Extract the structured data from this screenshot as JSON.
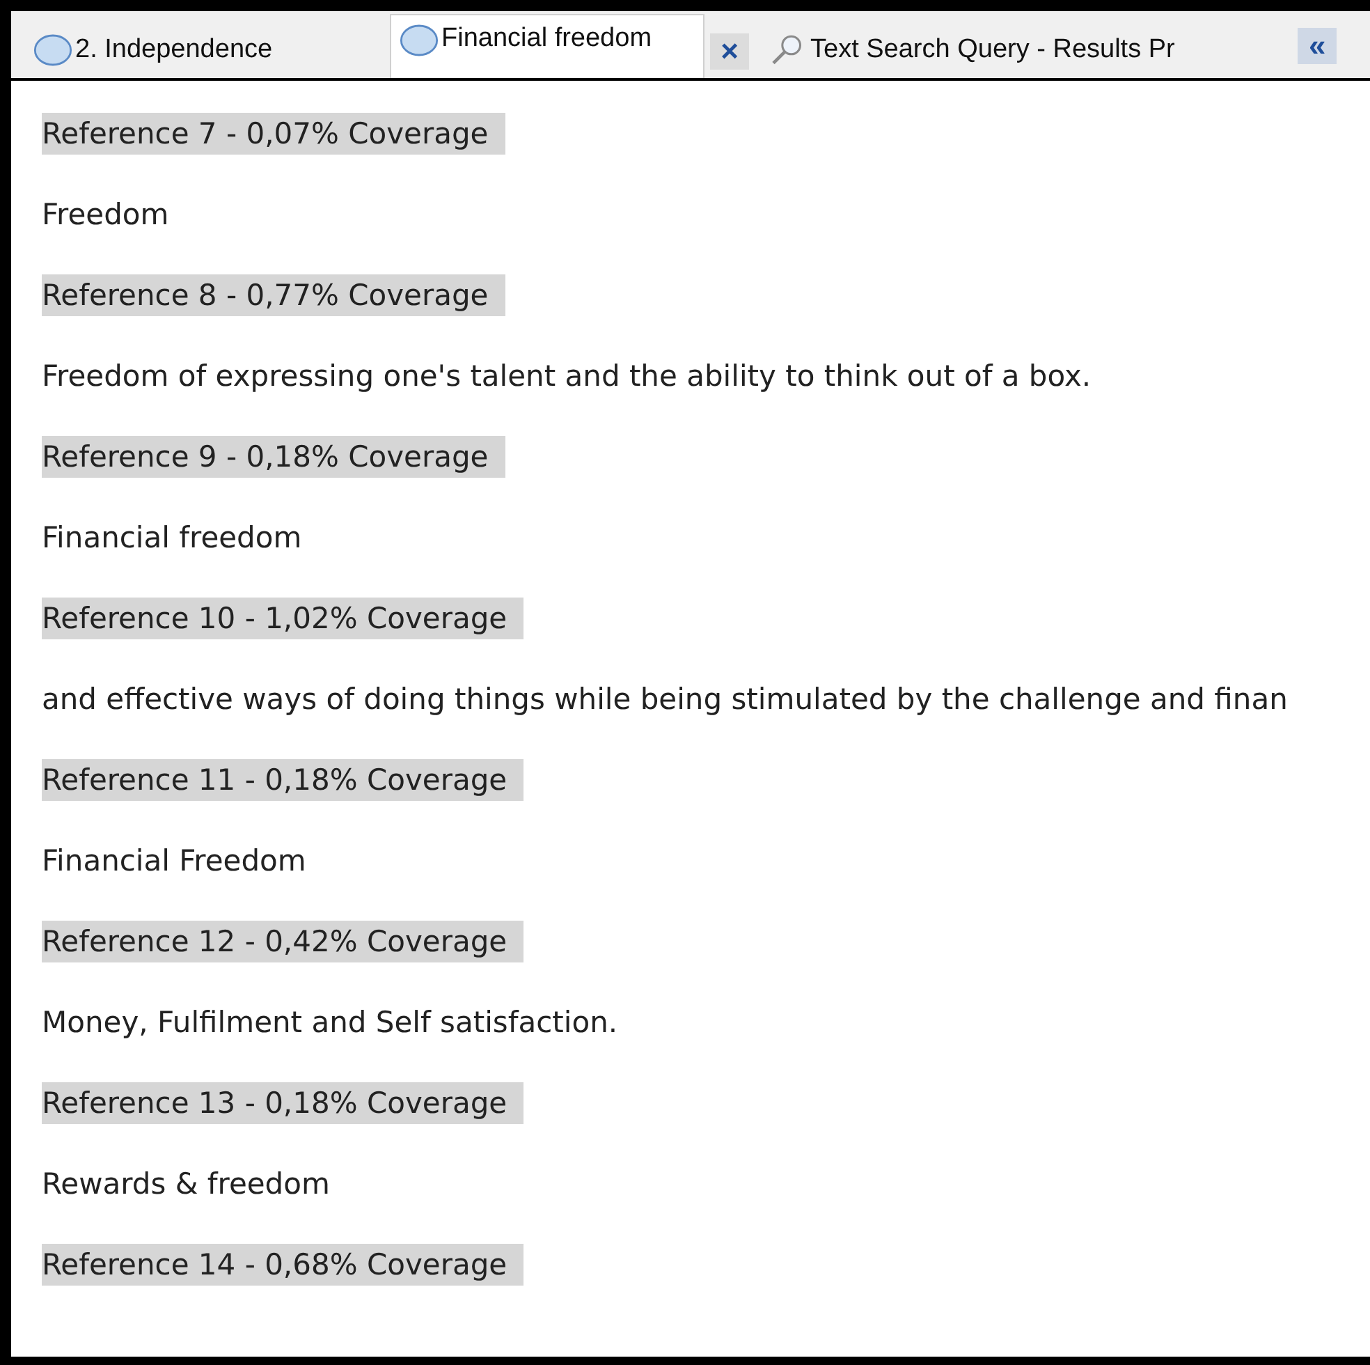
{
  "tabs": [
    {
      "label": "2. Independence",
      "kind": "node",
      "selected": false
    },
    {
      "label": "Financial freedom",
      "kind": "node",
      "selected": true,
      "close": "×"
    },
    {
      "label": "Text Search Query - Results Pr",
      "kind": "query",
      "selected": false
    }
  ],
  "scroll_button": "«",
  "entries": [
    {
      "kind": "reference",
      "text": "Reference 7 - 0,07% Coverage"
    },
    {
      "kind": "text",
      "text": "Freedom"
    },
    {
      "kind": "reference",
      "text": "Reference 8 - 0,77% Coverage"
    },
    {
      "kind": "text",
      "text": "Freedom of expressing one's talent and the ability to think out of a box."
    },
    {
      "kind": "reference",
      "text": "Reference 9 - 0,18% Coverage"
    },
    {
      "kind": "text",
      "text": "Financial freedom"
    },
    {
      "kind": "reference",
      "text": "Reference 10 - 1,02% Coverage"
    },
    {
      "kind": "text",
      "text": "and effective ways of doing things while being stimulated by the challenge and finan"
    },
    {
      "kind": "reference",
      "text": "Reference 11 - 0,18% Coverage"
    },
    {
      "kind": "text",
      "text": "Financial Freedom"
    },
    {
      "kind": "reference",
      "text": "Reference 12 - 0,42% Coverage"
    },
    {
      "kind": "text",
      "text": "Money, Fulfilment and Self satisfaction."
    },
    {
      "kind": "reference",
      "text": "Reference 13 - 0,18% Coverage"
    },
    {
      "kind": "text",
      "text": "Rewards & freedom"
    },
    {
      "kind": "reference",
      "text": "Reference 14 - 0,68% Coverage"
    }
  ]
}
